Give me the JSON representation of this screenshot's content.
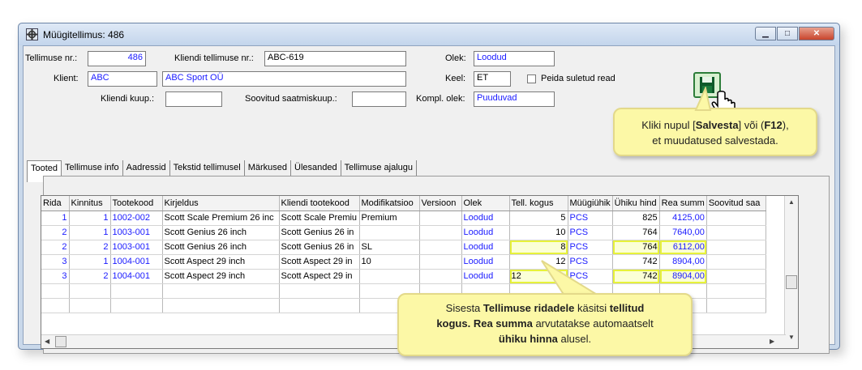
{
  "window": {
    "title": "Müügitellimus: 486"
  },
  "header": {
    "order_nr_label": "Tellimuse nr.:",
    "order_nr_value": "486",
    "client_order_label": "Kliendi tellimuse nr.:",
    "client_order_value": "ABC-619",
    "status_label": "Olek:",
    "status_value": "Loodud",
    "client_label": "Klient:",
    "client_code": "ABC",
    "client_name": "ABC Sport OÜ",
    "lang_label": "Keel:",
    "lang_value": "ET",
    "hide_closed_label": "Peida suletud read",
    "client_buyer_label": "Kliendi kuup.:",
    "client_buyer_value": "",
    "preferred_ship_label": "Soovitud saatmiskuup.:",
    "preferred_ship_value": "",
    "compl_status_label": "Kompl. olek:",
    "compl_status_value": "Puuduvad"
  },
  "tabs": [
    "Tooted",
    "Tellimuse info",
    "Aadressid",
    "Tekstid tellimusel",
    "Märkused",
    "Ülesanded",
    "Tellimuse ajalugu"
  ],
  "table": {
    "columns": [
      "Rida",
      "Kinnitus",
      "Tootekood",
      "Kirjeldus",
      "Kliendi tootekood",
      "Modifikatsioo",
      "Versioon",
      "Olek",
      "Tell. kogus",
      "Müügiühik",
      "Ühiku hind",
      "Rea summ",
      "Soovitud saa"
    ],
    "rows": [
      [
        "1",
        "1",
        "1002-002",
        "Scott Scale Premium 26 inc",
        "Scott Scale Premiu",
        "Premium",
        "",
        "Loodud",
        "5",
        "PCS",
        "825",
        "4125,00",
        ""
      ],
      [
        "2",
        "1",
        "1003-001",
        "Scott Genius 26 inch",
        "Scott Genius 26 in",
        "",
        "",
        "Loodud",
        "10",
        "PCS",
        "764",
        "7640,00",
        ""
      ],
      [
        "2",
        "2",
        "1003-001",
        "Scott Genius 26 inch",
        "Scott Genius 26 in",
        "SL",
        "",
        "Loodud",
        "8",
        "PCS",
        "764",
        "6112,00",
        ""
      ],
      [
        "3",
        "1",
        "1004-001",
        "Scott Aspect 29 inch",
        "Scott Aspect 29 in",
        "10",
        "",
        "Loodud",
        "12",
        "PCS",
        "742",
        "8904,00",
        ""
      ],
      [
        "3",
        "2",
        "1004-001",
        "Scott Aspect 29 inch",
        "Scott Aspect 29 in",
        "",
        "",
        "Loodud",
        "12",
        "PCS",
        "742",
        "8904,00",
        ""
      ]
    ]
  },
  "callout_save": {
    "line1_a": "Kliki nupul [",
    "line1_b": "Salvesta",
    "line1_c": "] või (",
    "line1_d": "F12",
    "line1_e": "),",
    "line2": "et muudatused salvestada."
  },
  "callout_qty": {
    "p1": "Sisesta ",
    "p2": "Tellimuse ridadele",
    "p3": " käsitsi ",
    "p4": "tellitud",
    "p5": "kogus.",
    "p6": " ",
    "p7": "Rea summa",
    "p8": " arvutatakse automaatselt",
    "p9": "ühiku hinna",
    "p10": " alusel."
  },
  "colors": {
    "accent_blue": "#1a1aff",
    "highlight": "#e7f23a",
    "callout_bg": "#fcf8a6"
  }
}
